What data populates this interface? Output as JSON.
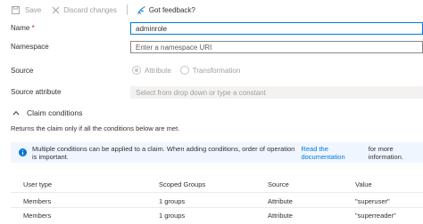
{
  "toolbar": {
    "save_label": "Save",
    "discard_label": "Discard changes",
    "feedback_label": "Got feedback?"
  },
  "form": {
    "name_label": "Name",
    "name_required_mark": "*",
    "name_value": "adminrole",
    "namespace_label": "Namespace",
    "namespace_placeholder": "Enter a namespace URI",
    "source_label": "Source",
    "source_options": [
      "Attribute",
      "Transformation"
    ],
    "source_selected": "Attribute",
    "source_attribute_label": "Source attribute",
    "source_attribute_placeholder": "Select from drop down or type a constant"
  },
  "claim_conditions": {
    "title": "Claim conditions",
    "description": "Returns the claim only if all the conditions below are met.",
    "info_text": "Multiple conditions can be applied to a claim.  When adding conditions, order of operation is important.",
    "info_link": "Read the documentation",
    "info_suffix": "for more information.",
    "columns": [
      "User type",
      "Scoped Groups",
      "Source",
      "Value"
    ],
    "rows": [
      [
        "Members",
        "1 groups",
        "Attribute",
        "\"superuser\""
      ],
      [
        "Members",
        "1 groups",
        "Attribute",
        "\"superreader\""
      ]
    ]
  },
  "colors": {
    "accent": "#0078d4",
    "required": "#a4262c",
    "info_bg": "#f0f6ff"
  }
}
